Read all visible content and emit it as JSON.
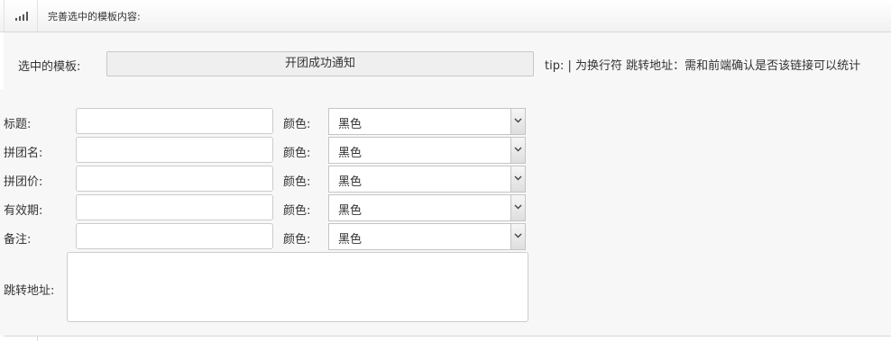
{
  "header": {
    "title": "完善选中的模板内容:",
    "icon": "signal-bars-icon"
  },
  "template": {
    "label": "选中的模板:",
    "selected": "开团成功通知",
    "tip": "tip: | 为换行符 跳转地址：需和前端确认是否该链接可以统计"
  },
  "form": {
    "color_label": "颜色:",
    "rows": [
      {
        "label": "标题:",
        "value": "",
        "color": "黑色"
      },
      {
        "label": "拼团名:",
        "value": "",
        "color": "黑色"
      },
      {
        "label": "拼团价:",
        "value": "",
        "color": "黑色"
      },
      {
        "label": "有效期:",
        "value": "",
        "color": "黑色"
      },
      {
        "label": "备注:",
        "value": "",
        "color": "黑色"
      }
    ],
    "url_label": "跳转地址:",
    "url_value": ""
  }
}
